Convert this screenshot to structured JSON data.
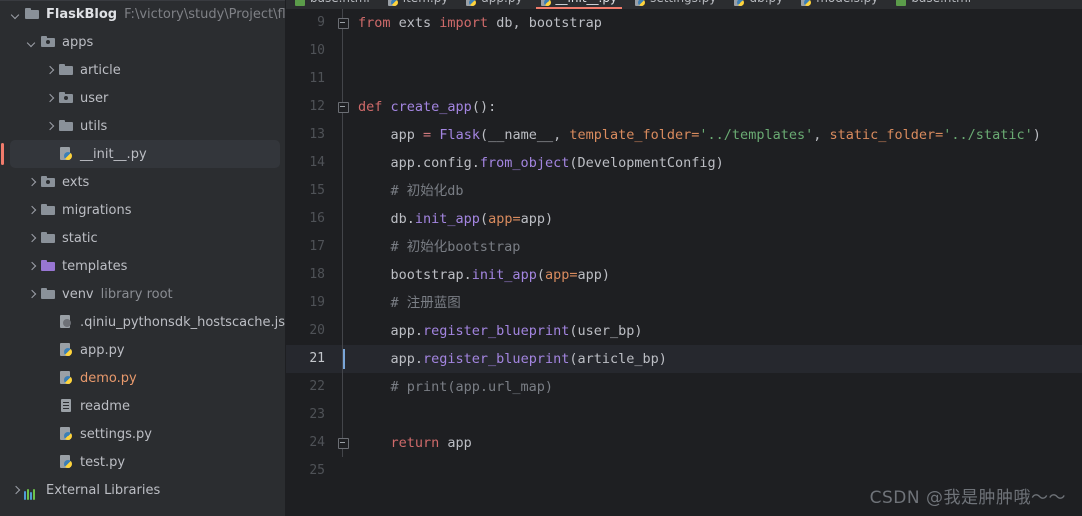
{
  "project": {
    "name": "FlaskBlog",
    "path": "F:\\victory\\study\\Project\\flask\\Fl",
    "tree": [
      {
        "label": "FlaskBlog",
        "suffix": "F:\\victory\\study\\Project\\flask\\Fl",
        "icon": "folder-icon",
        "depth": 0,
        "state": "expanded",
        "style": "bold"
      },
      {
        "label": "apps",
        "suffix": "",
        "icon": "folder-package-icon",
        "depth": 1,
        "state": "expanded",
        "style": "normal"
      },
      {
        "label": "article",
        "suffix": "",
        "icon": "folder-icon",
        "depth": 2,
        "state": "collapsed",
        "style": "normal"
      },
      {
        "label": "user",
        "suffix": "",
        "icon": "folder-package-icon",
        "depth": 2,
        "state": "collapsed",
        "style": "normal"
      },
      {
        "label": "utils",
        "suffix": "",
        "icon": "folder-icon",
        "depth": 2,
        "state": "collapsed",
        "style": "normal"
      },
      {
        "label": "__init__.py",
        "suffix": "",
        "icon": "python-file-icon",
        "depth": 2,
        "state": "leaf",
        "style": "normal",
        "selected": true
      },
      {
        "label": "exts",
        "suffix": "",
        "icon": "folder-package-icon",
        "depth": 1,
        "state": "collapsed",
        "style": "normal"
      },
      {
        "label": "migrations",
        "suffix": "",
        "icon": "folder-icon",
        "depth": 1,
        "state": "collapsed",
        "style": "normal"
      },
      {
        "label": "static",
        "suffix": "",
        "icon": "folder-icon",
        "depth": 1,
        "state": "collapsed",
        "style": "normal"
      },
      {
        "label": "templates",
        "suffix": "",
        "icon": "folder-templates-icon",
        "depth": 1,
        "state": "collapsed",
        "style": "normal"
      },
      {
        "label": "venv",
        "suffix": "library root",
        "icon": "folder-icon",
        "depth": 1,
        "state": "collapsed",
        "style": "normal"
      },
      {
        "label": ".qiniu_pythonsdk_hostscache.json",
        "suffix": "",
        "icon": "json-file-icon",
        "depth": 2,
        "state": "leaf",
        "style": "normal"
      },
      {
        "label": "app.py",
        "suffix": "",
        "icon": "python-file-icon",
        "depth": 2,
        "state": "leaf",
        "style": "normal"
      },
      {
        "label": "demo.py",
        "suffix": "",
        "icon": "python-file-icon",
        "depth": 2,
        "state": "leaf",
        "style": "orange"
      },
      {
        "label": "readme",
        "suffix": "",
        "icon": "text-file-icon",
        "depth": 2,
        "state": "leaf",
        "style": "normal"
      },
      {
        "label": "settings.py",
        "suffix": "",
        "icon": "python-file-icon",
        "depth": 2,
        "state": "leaf",
        "style": "normal"
      },
      {
        "label": "test.py",
        "suffix": "",
        "icon": "python-file-icon",
        "depth": 2,
        "state": "leaf",
        "style": "normal"
      },
      {
        "label": "External Libraries",
        "suffix": "",
        "icon": "external-libraries-icon",
        "depth": 0,
        "state": "collapsed",
        "style": "normal"
      }
    ]
  },
  "editor": {
    "tabs": [
      {
        "label": "base.html",
        "icon": "html-file-icon",
        "active": false
      },
      {
        "label": "item.py",
        "icon": "python-file-icon",
        "active": false
      },
      {
        "label": "app.py",
        "icon": "python-file-icon",
        "active": false
      },
      {
        "label": "__init__.py",
        "icon": "python-file-icon",
        "active": true
      },
      {
        "label": "settings.py",
        "icon": "python-file-icon",
        "active": false
      },
      {
        "label": "db.py",
        "icon": "python-file-icon",
        "active": false
      },
      {
        "label": "models.py",
        "icon": "python-file-icon",
        "active": false
      },
      {
        "label": "base.html",
        "icon": "html-file-icon",
        "active": false
      }
    ],
    "active_tab_accent": "#f07b6b",
    "current_line": 21,
    "lines": [
      {
        "n": "9",
        "fold": "start",
        "current": false,
        "tokens": [
          {
            "t": "from",
            "c": "kw"
          },
          {
            "t": " exts ",
            "c": "txt"
          },
          {
            "t": "import",
            "c": "kw"
          },
          {
            "t": " db, bootstrap",
            "c": "txt"
          }
        ]
      },
      {
        "n": "10",
        "fold": "line",
        "current": false,
        "tokens": []
      },
      {
        "n": "11",
        "fold": "line",
        "current": false,
        "tokens": []
      },
      {
        "n": "12",
        "fold": "start",
        "current": false,
        "tokens": [
          {
            "t": "def",
            "c": "kw"
          },
          {
            "t": " ",
            "c": "txt"
          },
          {
            "t": "create_app",
            "c": "fn"
          },
          {
            "t": "():",
            "c": "txt"
          }
        ]
      },
      {
        "n": "13",
        "fold": "line",
        "current": false,
        "tokens": [
          {
            "t": "    app ",
            "c": "txt"
          },
          {
            "t": "=",
            "c": "kw2"
          },
          {
            "t": " ",
            "c": "txt"
          },
          {
            "t": "Flask",
            "c": "cls"
          },
          {
            "t": "(__name__, ",
            "c": "txt"
          },
          {
            "t": "template_folder",
            "c": "kwarg"
          },
          {
            "t": "=",
            "c": "kwarg"
          },
          {
            "t": "'../templates'",
            "c": "str"
          },
          {
            "t": ", ",
            "c": "txt"
          },
          {
            "t": "static_folder",
            "c": "kwarg"
          },
          {
            "t": "=",
            "c": "kwarg"
          },
          {
            "t": "'../static'",
            "c": "str"
          },
          {
            "t": ")",
            "c": "txt"
          }
        ]
      },
      {
        "n": "14",
        "fold": "line",
        "current": false,
        "tokens": [
          {
            "t": "    app.config.",
            "c": "txt"
          },
          {
            "t": "from_object",
            "c": "fn"
          },
          {
            "t": "(DevelopmentConfig)",
            "c": "txt"
          }
        ]
      },
      {
        "n": "15",
        "fold": "line",
        "current": false,
        "tokens": [
          {
            "t": "    # 初始化db",
            "c": "cmt"
          }
        ]
      },
      {
        "n": "16",
        "fold": "line",
        "current": false,
        "tokens": [
          {
            "t": "    db.",
            "c": "txt"
          },
          {
            "t": "init_app",
            "c": "fn"
          },
          {
            "t": "(",
            "c": "txt"
          },
          {
            "t": "app",
            "c": "kwarg"
          },
          {
            "t": "=",
            "c": "kwarg"
          },
          {
            "t": "app)",
            "c": "txt"
          }
        ]
      },
      {
        "n": "17",
        "fold": "line",
        "current": false,
        "tokens": [
          {
            "t": "    # 初始化bootstrap",
            "c": "cmt"
          }
        ]
      },
      {
        "n": "18",
        "fold": "line",
        "current": false,
        "tokens": [
          {
            "t": "    bootstrap.",
            "c": "txt"
          },
          {
            "t": "init_app",
            "c": "fn"
          },
          {
            "t": "(",
            "c": "txt"
          },
          {
            "t": "app",
            "c": "kwarg"
          },
          {
            "t": "=",
            "c": "kwarg"
          },
          {
            "t": "app)",
            "c": "txt"
          }
        ]
      },
      {
        "n": "19",
        "fold": "line",
        "current": false,
        "tokens": [
          {
            "t": "    # 注册蓝图",
            "c": "cmt"
          }
        ]
      },
      {
        "n": "20",
        "fold": "line",
        "current": false,
        "tokens": [
          {
            "t": "    app.",
            "c": "txt"
          },
          {
            "t": "register_blueprint",
            "c": "fn"
          },
          {
            "t": "(user_bp)",
            "c": "txt"
          }
        ]
      },
      {
        "n": "21",
        "fold": "line",
        "current": true,
        "tokens": [
          {
            "t": "    app.",
            "c": "txt"
          },
          {
            "t": "register_blueprint",
            "c": "fn"
          },
          {
            "t": "(article_bp)",
            "c": "txt"
          }
        ]
      },
      {
        "n": "22",
        "fold": "line",
        "current": false,
        "tokens": [
          {
            "t": "    # print(app.url_map)",
            "c": "cmt"
          }
        ]
      },
      {
        "n": "23",
        "fold": "line",
        "current": false,
        "tokens": []
      },
      {
        "n": "24",
        "fold": "end",
        "current": false,
        "tokens": [
          {
            "t": "    ",
            "c": "txt"
          },
          {
            "t": "return",
            "c": "kw"
          },
          {
            "t": " app",
            "c": "txt"
          }
        ]
      },
      {
        "n": "25",
        "fold": "none",
        "current": false,
        "tokens": []
      }
    ]
  },
  "watermark": {
    "text": "CSDN @我是肿肿哦～～"
  }
}
